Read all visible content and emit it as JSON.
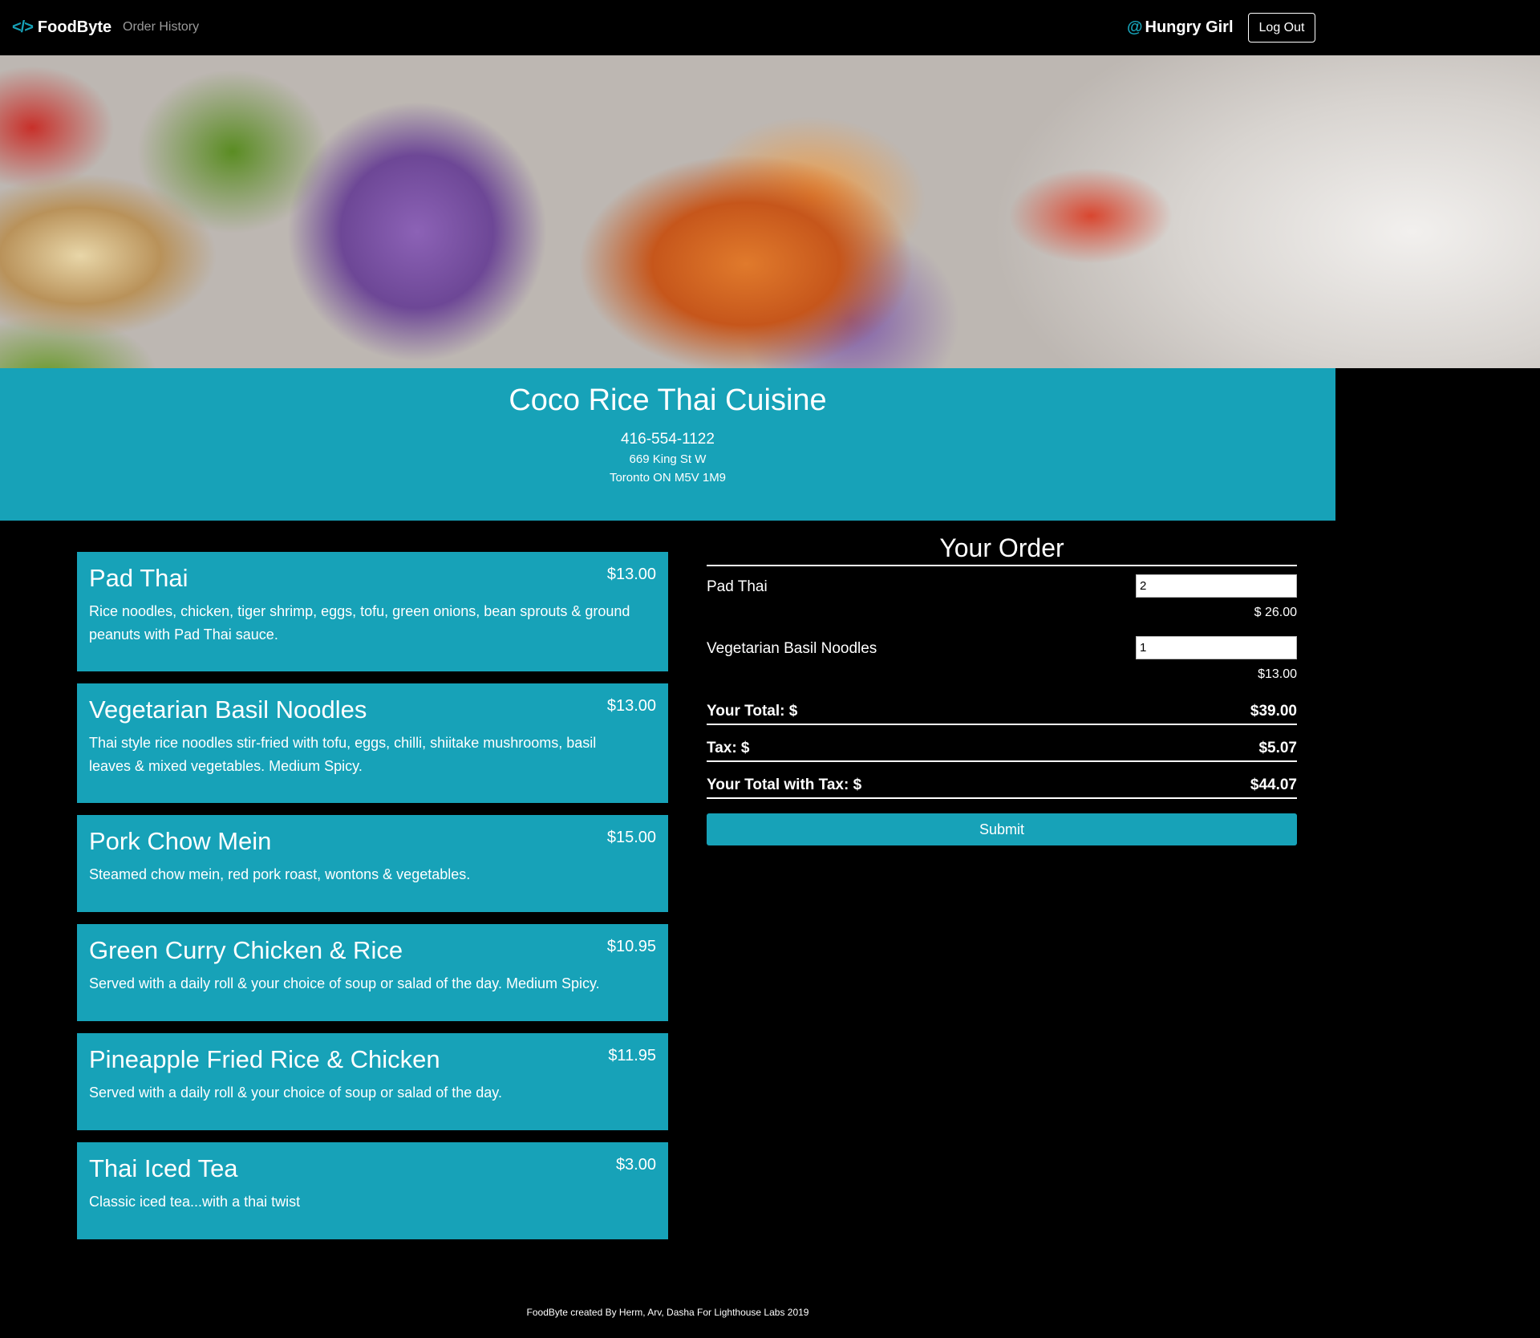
{
  "nav": {
    "brand": "FoodByte",
    "brand_icon": "code-icon",
    "order_history": "Order History",
    "user_name": "Hungry Girl",
    "user_icon": "at-icon",
    "logout": "Log Out"
  },
  "restaurant": {
    "name": "Coco Rice Thai Cuisine",
    "phone": "416-554-1122",
    "address_line1": "669 King St W",
    "address_line2": "Toronto ON M5V 1M9"
  },
  "menu": [
    {
      "name": "Pad Thai",
      "price": "$13.00",
      "description": "Rice noodles, chicken, tiger shrimp, eggs, tofu, green onions, bean sprouts & ground peanuts with Pad Thai sauce."
    },
    {
      "name": "Vegetarian Basil Noodles",
      "price": "$13.00",
      "description": "Thai style rice noodles stir-fried with tofu, eggs, chilli, shiitake mushrooms, basil leaves & mixed vegetables. Medium Spicy."
    },
    {
      "name": "Pork Chow Mein",
      "price": "$15.00",
      "description": "Steamed chow mein, red pork roast, wontons & vegetables."
    },
    {
      "name": "Green Curry Chicken & Rice",
      "price": "$10.95",
      "description": "Served with a daily roll & your choice of soup or salad of the day. Medium Spicy."
    },
    {
      "name": "Pineapple Fried Rice & Chicken",
      "price": "$11.95",
      "description": "Served with a daily roll & your choice of soup or salad of the day."
    },
    {
      "name": "Thai Iced Tea",
      "price": "$3.00",
      "description": "Classic iced tea...with a thai twist"
    }
  ],
  "order": {
    "title": "Your Order",
    "items": [
      {
        "name": "Pad Thai",
        "quantity": "2",
        "subtotal": "$ 26.00"
      },
      {
        "name": "Vegetarian Basil Noodles",
        "quantity": "1",
        "subtotal": "$13.00"
      }
    ],
    "total_label": "Your Total: $",
    "total_value": "$39.00",
    "tax_label": "Tax: $",
    "tax_value": "$5.07",
    "total_tax_label": "Your Total with Tax: $",
    "total_tax_value": "$44.07",
    "submit": "Submit"
  },
  "footer": "FoodByte created By Herm, Arv, Dasha For Lighthouse Labs 2019",
  "colors": {
    "accent": "#17a2b8",
    "background": "#000000"
  }
}
